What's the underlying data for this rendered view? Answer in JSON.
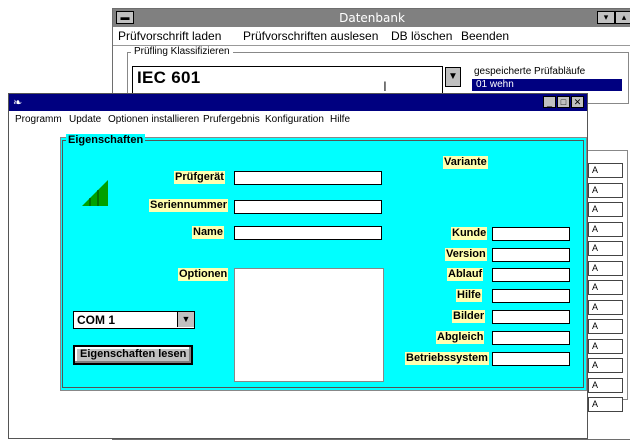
{
  "back_window": {
    "title": "Datenbank",
    "menu": [
      "Prüfvorschrift laden",
      "Prüfvorschriften auslesen",
      "DB löschen",
      "Beenden"
    ],
    "group_label": "Prüfling Klassifizieren",
    "classification_value": "IEC 601",
    "saved_label": "gespeicherte Prüfabläufe",
    "saved_item": "01 wehn",
    "row_marks": [
      "A",
      "A",
      "A",
      "A",
      "A",
      "A",
      "A",
      "A",
      "A",
      "A",
      "A",
      "A",
      "A",
      "A",
      "A"
    ]
  },
  "front_window": {
    "menu": {
      "programm": "Programm",
      "update": "Update",
      "optionen": "Optionen installieren",
      "pruefergebnis": "Prufergebnis",
      "konfiguration": "Konfiguration",
      "hilfe": "Hilfe"
    },
    "panel_title": "Eigenschaften",
    "labels": {
      "pruefgeraet": "Prüfgerät",
      "seriennummer": "Seriennummer",
      "name": "Name",
      "optionen": "Optionen",
      "variante": "Variante",
      "kunde": "Kunde",
      "version": "Version",
      "ablauf": "Ablauf",
      "hilfe": "Hilfe",
      "bilder": "Bilder",
      "abgleich": "Abgleich",
      "betriebssystem": "Betriebssystem"
    },
    "values": {
      "pruefgeraet": "",
      "seriennummer": "",
      "name": "",
      "kunde": "",
      "version": "",
      "ablauf": "",
      "hilfe": "",
      "bilder": "",
      "abgleich": "",
      "betriebssystem": ""
    },
    "com_port": "COM 1",
    "read_button": "Eigenschaften lesen"
  },
  "colors": {
    "panel_bg": "#00ffff",
    "label_bg": "#ffffb0",
    "active_title": "#000080",
    "inactive_title": "#808080",
    "signal_icon": "#00a000"
  }
}
